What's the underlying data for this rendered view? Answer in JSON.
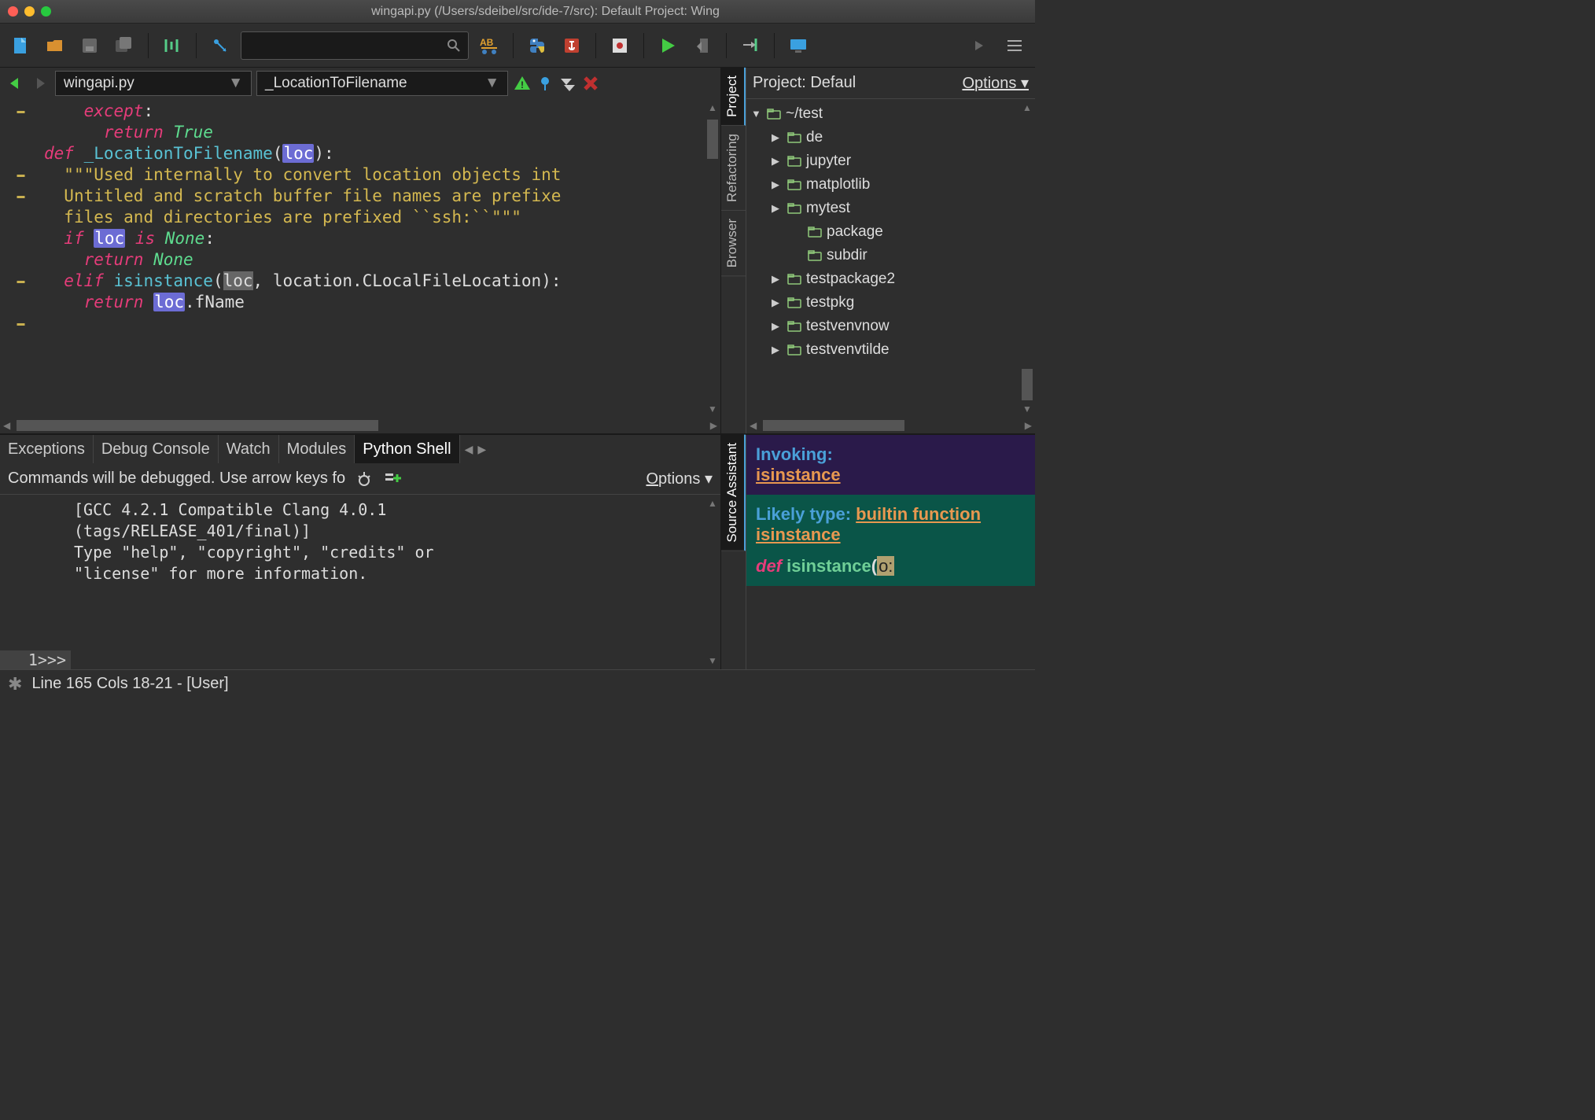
{
  "window": {
    "title": "wingapi.py (/Users/sdeibel/src/ide-7/src): Default Project: Wing"
  },
  "toolbar": {
    "search_placeholder": ""
  },
  "editor": {
    "file_dropdown": "wingapi.py",
    "symbol_dropdown": "_LocationToFilename",
    "lines": [
      {
        "indent": 2,
        "fold": true,
        "segments": [
          {
            "t": "except",
            "c": "kw"
          },
          {
            "t": ":",
            "c": "plain"
          }
        ]
      },
      {
        "indent": 3,
        "segments": [
          {
            "t": "return ",
            "c": "kw2"
          },
          {
            "t": "True",
            "c": "val"
          }
        ]
      },
      {
        "indent": 0,
        "segments": [
          {
            "t": "",
            "c": "plain"
          }
        ]
      },
      {
        "indent": 0,
        "fold": true,
        "segments": [
          {
            "t": "def ",
            "c": "kw"
          },
          {
            "t": "_LocationToFilename",
            "c": "fn"
          },
          {
            "t": "(",
            "c": "plain"
          },
          {
            "t": "loc",
            "c": "hl"
          },
          {
            "t": "):",
            "c": "plain"
          }
        ]
      },
      {
        "indent": 1,
        "fold": true,
        "segments": [
          {
            "t": "\"\"\"Used internally to convert location objects int",
            "c": "str"
          }
        ]
      },
      {
        "indent": 1,
        "segments": [
          {
            "t": "Untitled and scratch buffer file names are prefixe",
            "c": "str"
          }
        ]
      },
      {
        "indent": 1,
        "segments": [
          {
            "t": "files and directories are prefixed ``ssh:``\"\"\"",
            "c": "str"
          }
        ]
      },
      {
        "indent": 0,
        "segments": [
          {
            "t": "",
            "c": "plain"
          }
        ]
      },
      {
        "indent": 1,
        "fold": true,
        "segments": [
          {
            "t": "if ",
            "c": "kw"
          },
          {
            "t": "loc",
            "c": "hl"
          },
          {
            "t": " is ",
            "c": "kw"
          },
          {
            "t": "None",
            "c": "val"
          },
          {
            "t": ":",
            "c": "plain"
          }
        ]
      },
      {
        "indent": 2,
        "segments": [
          {
            "t": "return ",
            "c": "kw2"
          },
          {
            "t": "None",
            "c": "val"
          }
        ]
      },
      {
        "indent": 1,
        "fold": true,
        "segments": [
          {
            "t": "elif ",
            "c": "kw"
          },
          {
            "t": "isinstance",
            "c": "fn"
          },
          {
            "t": "(",
            "c": "plain"
          },
          {
            "t": "loc",
            "c": "sel"
          },
          {
            "t": ", location.CLocalFileLocation):",
            "c": "plain"
          }
        ]
      },
      {
        "indent": 2,
        "segments": [
          {
            "t": "return ",
            "c": "kw2"
          },
          {
            "t": "loc",
            "c": "hl"
          },
          {
            "t": ".fName",
            "c": "plain"
          }
        ]
      }
    ]
  },
  "side_tabs": [
    "Project",
    "Refactoring",
    "Browser"
  ],
  "project": {
    "title": "Project: Defaul",
    "options": "Options",
    "tree": [
      {
        "lvl": 1,
        "expand": "down",
        "name": "~/test"
      },
      {
        "lvl": 2,
        "expand": "right",
        "name": "de"
      },
      {
        "lvl": 2,
        "expand": "right",
        "name": "jupyter"
      },
      {
        "lvl": 2,
        "expand": "right",
        "name": "matplotlib"
      },
      {
        "lvl": 2,
        "expand": "right",
        "name": "mytest"
      },
      {
        "lvl": 3,
        "expand": "",
        "name": "package"
      },
      {
        "lvl": 3,
        "expand": "",
        "name": "subdir"
      },
      {
        "lvl": 2,
        "expand": "right",
        "name": "testpackage2"
      },
      {
        "lvl": 2,
        "expand": "right",
        "name": "testpkg"
      },
      {
        "lvl": 2,
        "expand": "right",
        "name": "testvenvnow"
      },
      {
        "lvl": 2,
        "expand": "right",
        "name": "testvenvtilde"
      }
    ]
  },
  "bottom_tabs": [
    "Exceptions",
    "Debug Console",
    "Watch",
    "Modules",
    "Python Shell"
  ],
  "shell": {
    "hint": "Commands will be debugged.  Use arrow keys fo",
    "options": "Options",
    "output": "[GCC 4.2.1 Compatible Clang 4.0.1\n(tags/RELEASE_401/final)]\nType \"help\", \"copyright\", \"credits\" or\n\"license\" for more information.",
    "prompt_num": "1>>>"
  },
  "assist_tab": "Source Assistant",
  "assist": {
    "invoking_label": "Invoking:",
    "invoking_link": "isinstance",
    "likely_label": "Likely type:",
    "likely_link": "builtin function isinstance",
    "sig_def": "def",
    "sig_fn": "isinstance",
    "sig_open": "(",
    "sig_p1": "o:"
  },
  "status": {
    "text": "Line 165 Cols 18-21 - [User]"
  }
}
